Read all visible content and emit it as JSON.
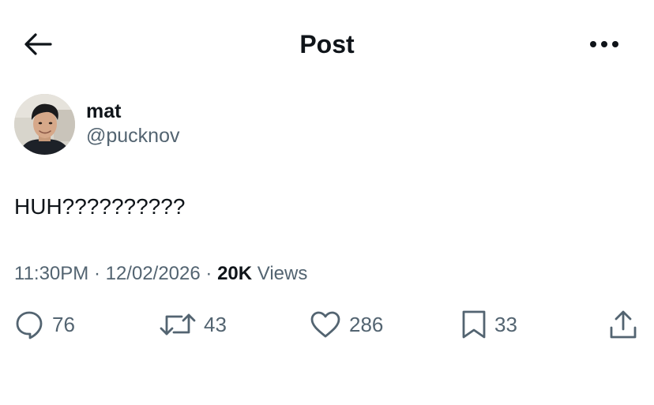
{
  "header": {
    "title": "Post",
    "back_icon": "arrow-left-icon",
    "more_icon": "more-horizontal-icon"
  },
  "author": {
    "display_name": "mat",
    "handle": "@pucknov"
  },
  "post": {
    "text": "HUH??????????"
  },
  "meta": {
    "time": "11:30PM",
    "date": "12/02/2026",
    "views_count": "20K",
    "views_label": "Views"
  },
  "actions": {
    "replies": "76",
    "reposts": "43",
    "likes": "286",
    "bookmarks": "33"
  },
  "colors": {
    "text_primary": "#0f1419",
    "text_secondary": "#536471",
    "background": "#ffffff"
  }
}
